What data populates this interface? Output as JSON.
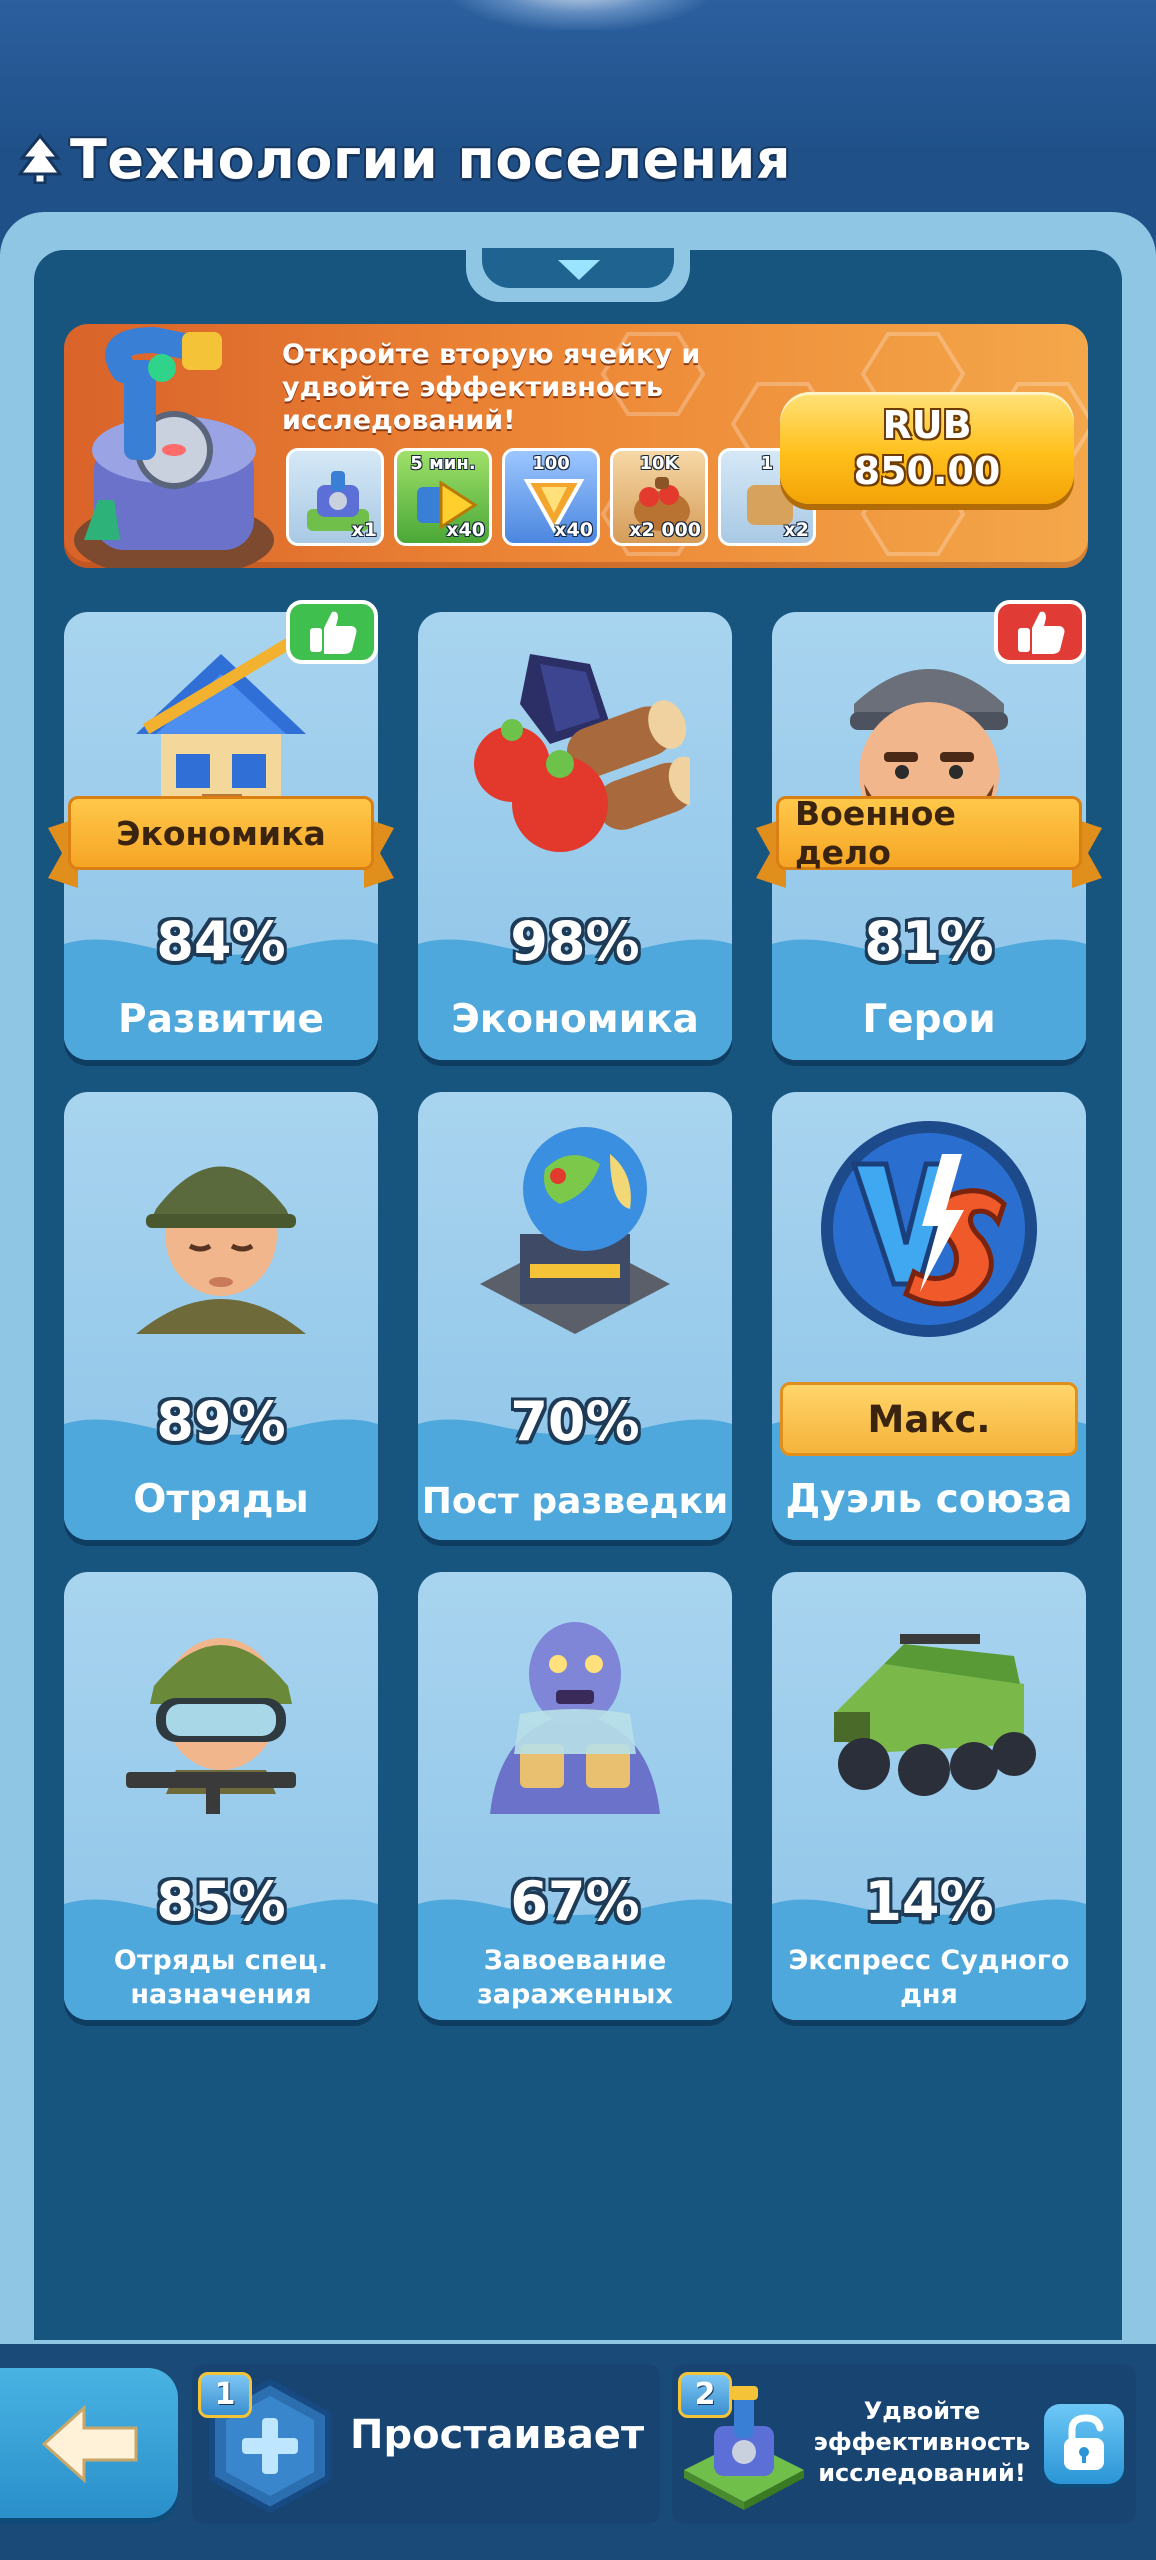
{
  "header": {
    "title": "Технологии поселения",
    "icon": "tree-icon"
  },
  "promo": {
    "text": "Откройте вторую ячейку и удвойте эффективность исследований!",
    "rewards": [
      {
        "icon": "lab-building-icon",
        "top_label": "",
        "qty": "x1"
      },
      {
        "icon": "speedup-icon",
        "top_label": "5 мин.",
        "qty": "x40"
      },
      {
        "icon": "v-gem-icon",
        "top_label": "100",
        "qty": "x40"
      },
      {
        "icon": "food-sack-icon",
        "top_label": "10K",
        "qty": "x2 000"
      },
      {
        "icon": "item-icon",
        "top_label": "1",
        "qty": "x2"
      }
    ],
    "price_currency": "RUB",
    "price_value": "850.00"
  },
  "cards": [
    {
      "name": "Развитие",
      "percent": "84%",
      "ribbon": "Экономика",
      "thumb": "green"
    },
    {
      "name": "Экономика",
      "percent": "98%"
    },
    {
      "name": "Герои",
      "percent": "81%",
      "ribbon": "Военное дело",
      "thumb": "red"
    },
    {
      "name": "Отряды",
      "percent": "89%"
    },
    {
      "name": "Пост разведки",
      "percent": "70%"
    },
    {
      "name": "Дуэль союза",
      "badge": "Макс."
    },
    {
      "name_line1": "Отряды спец.",
      "name_line2": "назначения",
      "percent": "85%"
    },
    {
      "name_line1": "Завоевание",
      "name_line2": "зараженных",
      "percent": "67%"
    },
    {
      "name_line1": "Экспресс Судного",
      "name_line2": "дня",
      "percent": "14%"
    }
  ],
  "bottom": {
    "slot1_number": "1",
    "slot1_label": "Простаивает",
    "slot2_number": "2",
    "slot2_label_line1": "Удвойте",
    "slot2_label_line2": "эффективность",
    "slot2_label_line3": "исследований!"
  },
  "colors": {
    "background": "#1c4a7e",
    "panel": "#17547e",
    "card": "#a8d4ef",
    "card_band": "#4ea8dc",
    "promo": "#ec8535",
    "button": "#ffc01c",
    "ribbon": "#f6a525"
  }
}
